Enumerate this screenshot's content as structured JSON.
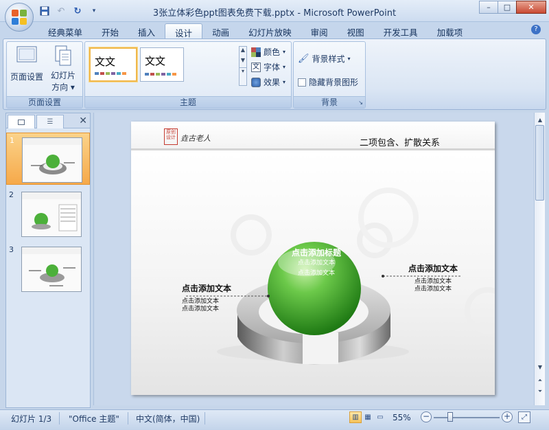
{
  "window": {
    "title": "3张立体彩色ppt图表免费下载.pptx - Microsoft PowerPoint",
    "controls": {
      "minimize": "–",
      "maximize": "□",
      "close": "✕"
    }
  },
  "quick_access": [
    "save-icon",
    "undo-icon",
    "redo-icon",
    "customize-icon"
  ],
  "ribbon": {
    "tabs": [
      "经典菜单",
      "开始",
      "插入",
      "设计",
      "动画",
      "幻灯片放映",
      "审阅",
      "视图",
      "开发工具",
      "加载项"
    ],
    "active_tab": "设计",
    "groups": {
      "page_setup": {
        "label": "页面设置",
        "page_setup_button": "页面设置",
        "orientation_button_line1": "幻灯片",
        "orientation_button_line2": "方向"
      },
      "themes": {
        "label": "主题",
        "tile_text": "文文",
        "colors": "颜色",
        "fonts": "字体",
        "effects": "效果"
      },
      "background": {
        "label": "背景",
        "styles": "背景样式",
        "hide_graphics": "隐藏背景图形"
      }
    },
    "help": "?"
  },
  "slide_pane": {
    "thumbnails": [
      {
        "number": "1",
        "selected": true
      },
      {
        "number": "2",
        "selected": false
      },
      {
        "number": "3",
        "selected": false
      }
    ]
  },
  "slide": {
    "logo_text": "垚古老人",
    "seal_text": "原创设计",
    "title": "二项包含、扩散关系",
    "center": {
      "heading": "点击添加标题",
      "line1": "点击添加文本",
      "line2": "点击添加文本"
    },
    "left": {
      "heading": "点击添加文本",
      "line1": "点击添加文本",
      "line2": "点击添加文本"
    },
    "right": {
      "heading": "点击添加文本",
      "line1": "点击添加文本",
      "line2": "点击添加文本"
    }
  },
  "status": {
    "slide_counter": "幻灯片 1/3",
    "theme": "\"Office 主题\"",
    "language": "中文(简体，中国)",
    "zoom": "55%",
    "zoom_fraction": 0.55
  },
  "colors": {
    "accent_orange": "#f6a94a",
    "sphere_green": "#3fa32a",
    "ribbon_blue": "#c5d6ec"
  }
}
